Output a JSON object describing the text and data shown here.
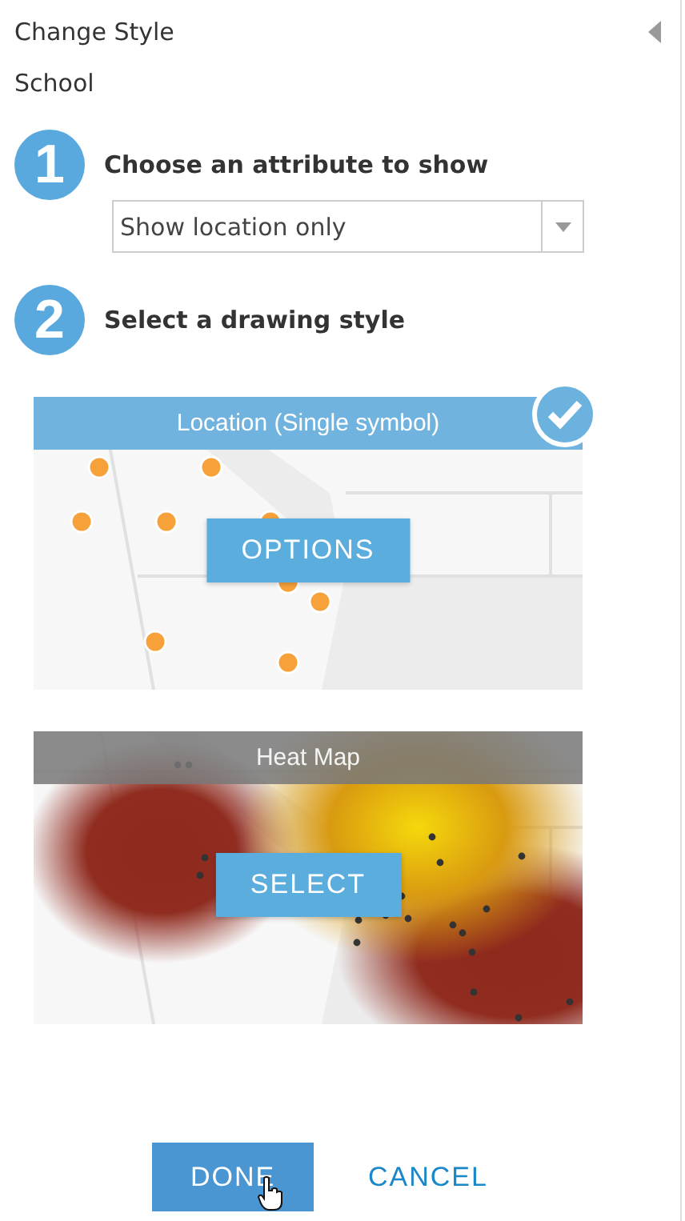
{
  "panel": {
    "title": "Change Style",
    "layer": "School"
  },
  "steps": [
    {
      "number": "1",
      "label": "Choose an attribute to show"
    },
    {
      "number": "2",
      "label": "Select a drawing style"
    }
  ],
  "attribute_dropdown": {
    "value": "Show location only"
  },
  "styles": [
    {
      "kind": "single",
      "label": "Location (Single symbol)",
      "selected": true,
      "button": "OPTIONS"
    },
    {
      "kind": "heat",
      "label": "Heat Map",
      "selected": false,
      "button": "SELECT"
    }
  ],
  "buttons": {
    "done": "DONE",
    "cancel": "CANCEL"
  }
}
